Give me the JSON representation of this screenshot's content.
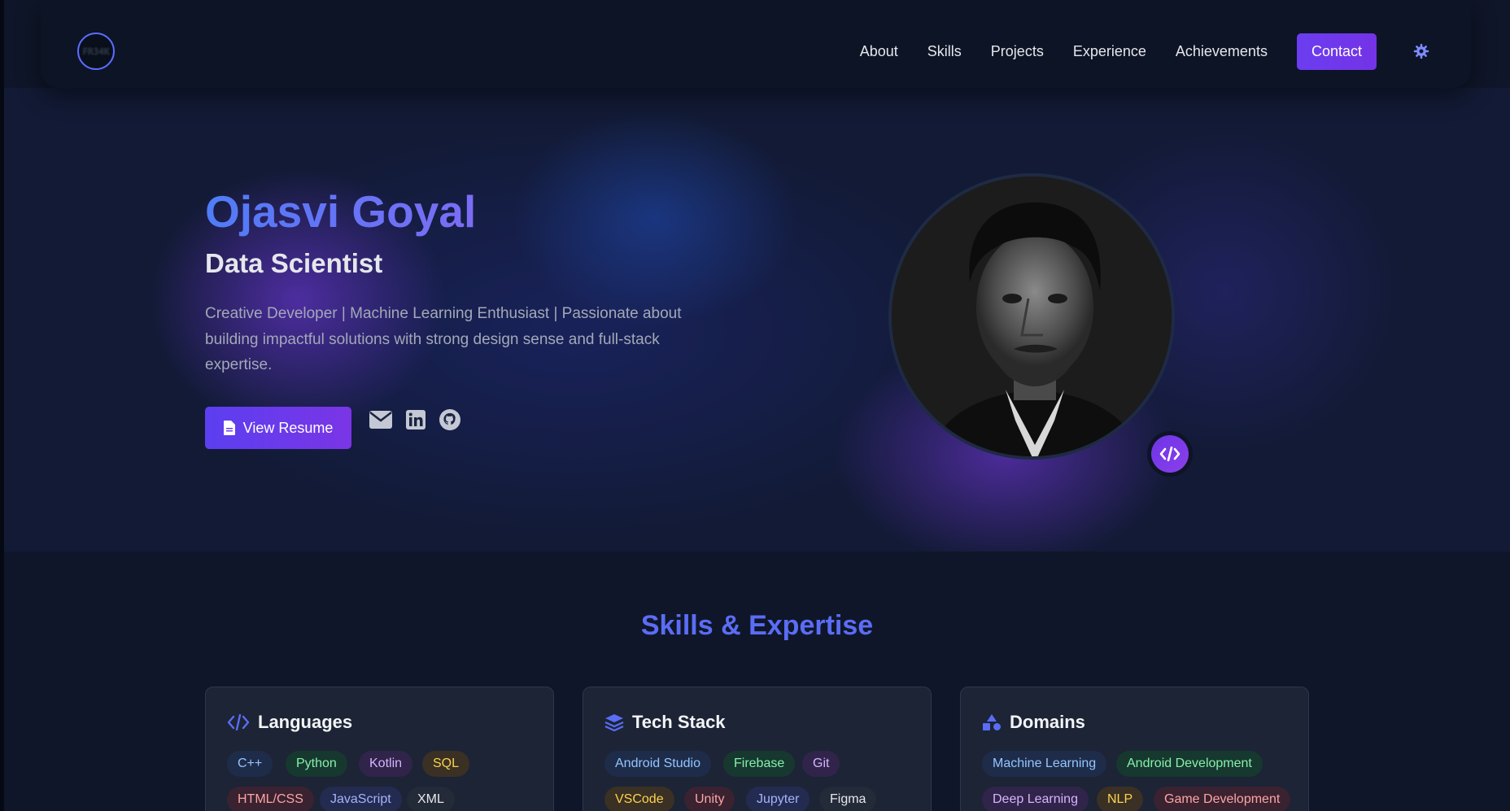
{
  "nav": {
    "logo_text": "FR34K",
    "links": [
      "About",
      "Skills",
      "Projects",
      "Experience",
      "Achievements"
    ],
    "contact_label": "Contact",
    "theme_icon": "gear-icon"
  },
  "hero": {
    "name": "Ojasvi Goyal",
    "role": "Data Scientist",
    "description": "Creative Developer | Machine Learning Enthusiast | Passionate about building impactful solutions with strong design sense and full-stack expertise.",
    "resume_label": "View Resume",
    "social_icons": [
      "envelope-icon",
      "linkedin-icon",
      "github-icon"
    ],
    "badge_icon": "code-icon"
  },
  "skills": {
    "title": "Skills & Expertise",
    "cards": [
      {
        "title": "Languages",
        "icon": "code-icon",
        "tags": [
          "C++",
          "Python",
          "Kotlin",
          "SQL",
          "HTML/CSS",
          "JavaScript",
          "XML"
        ]
      },
      {
        "title": "Tech Stack",
        "icon": "layers-icon",
        "tags": [
          "Android Studio",
          "Firebase",
          "Git",
          "VSCode",
          "Unity",
          "Jupyter",
          "Figma"
        ]
      },
      {
        "title": "Domains",
        "icon": "shapes-icon",
        "tags": [
          "Machine Learning",
          "Android Development",
          "Deep Learning",
          "NLP",
          "Game Development"
        ]
      }
    ]
  },
  "colors": {
    "accent": "#6d35e8",
    "name_gradient_start": "#4f7cf7",
    "name_gradient_end": "#7c6cf5",
    "section_title": "#5b6cf5",
    "card_bg": "#1c2436"
  }
}
